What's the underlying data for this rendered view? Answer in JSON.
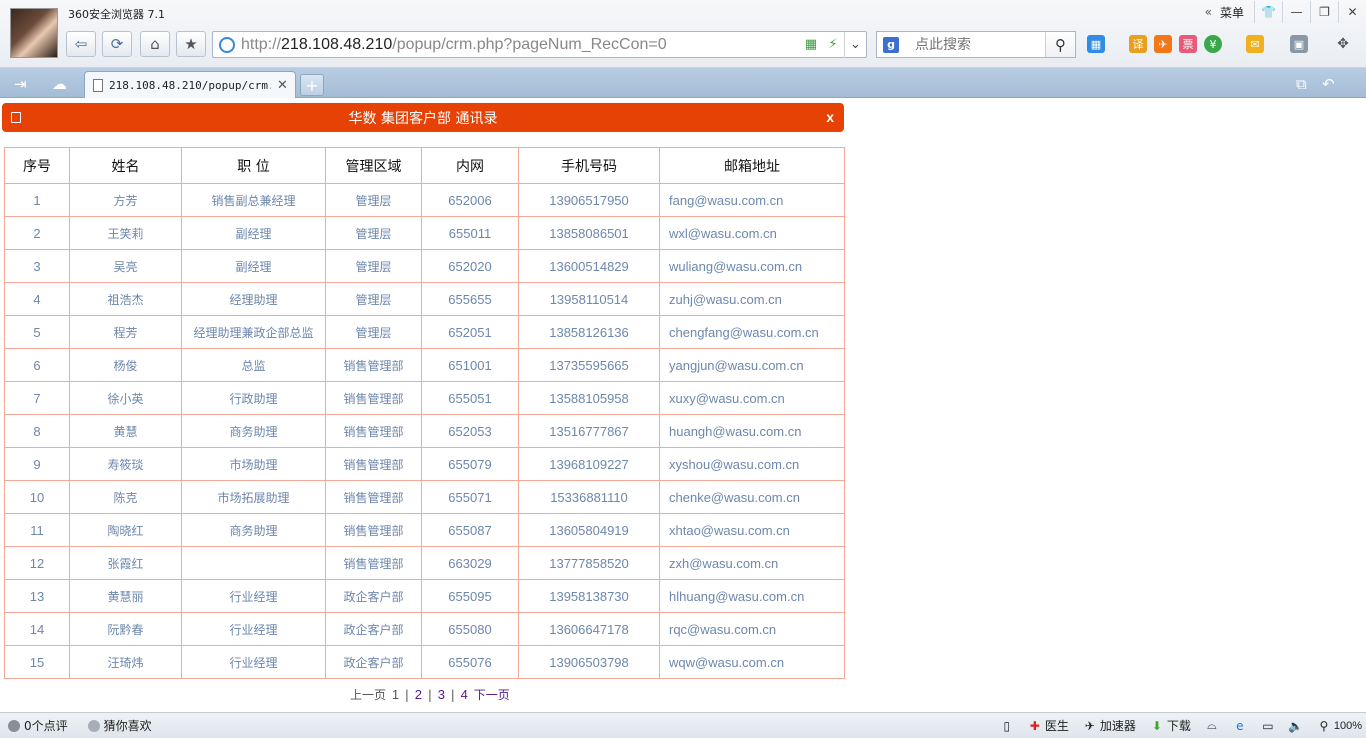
{
  "browser": {
    "app_title": "360安全浏览器 7.1",
    "menu_label": "菜单",
    "address_prefix": "http://",
    "address_host": "218.108.48.210",
    "address_path": "/popup/crm.php?pageNum_RecCon=0",
    "search_placeholder": "点此搜索",
    "tab_title": "218.108.48.210/popup/crm.php"
  },
  "page": {
    "header_title": "华数 集团客户部 通讯录",
    "close_label": "x",
    "columns": [
      "序号",
      "姓名",
      "职 位",
      "管理区域",
      "内网",
      "手机号码",
      "邮箱地址"
    ],
    "rows": [
      {
        "no": "1",
        "name": "方芳",
        "title": "销售副总兼经理",
        "area": "管理层",
        "ext": "652006",
        "mobile": "13906517950",
        "email": "fang@wasu.com.cn"
      },
      {
        "no": "2",
        "name": "王笑莉",
        "title": "副经理",
        "area": "管理层",
        "ext": "655011",
        "mobile": "13858086501",
        "email": "wxl@wasu.com.cn"
      },
      {
        "no": "3",
        "name": "吴亮",
        "title": "副经理",
        "area": "管理层",
        "ext": "652020",
        "mobile": "13600514829",
        "email": "wuliang@wasu.com.cn"
      },
      {
        "no": "4",
        "name": "祖浩杰",
        "title": "经理助理",
        "area": "管理层",
        "ext": "655655",
        "mobile": "13958110514",
        "email": "zuhj@wasu.com.cn"
      },
      {
        "no": "5",
        "name": "程芳",
        "title": "经理助理兼政企部总监",
        "area": "管理层",
        "ext": "652051",
        "mobile": "13858126136",
        "email": "chengfang@wasu.com.cn"
      },
      {
        "no": "6",
        "name": "杨俊",
        "title": "总监",
        "area": "销售管理部",
        "ext": "651001",
        "mobile": "13735595665",
        "email": "yangjun@wasu.com.cn"
      },
      {
        "no": "7",
        "name": "徐小英",
        "title": "行政助理",
        "area": "销售管理部",
        "ext": "655051",
        "mobile": "13588105958",
        "email": "xuxy@wasu.com.cn"
      },
      {
        "no": "8",
        "name": "黄慧",
        "title": "商务助理",
        "area": "销售管理部",
        "ext": "652053",
        "mobile": "13516777867",
        "email": "huangh@wasu.com.cn"
      },
      {
        "no": "9",
        "name": "寿筱琰",
        "title": "市场助理",
        "area": "销售管理部",
        "ext": "655079",
        "mobile": "13968109227",
        "email": "xyshou@wasu.com.cn"
      },
      {
        "no": "10",
        "name": "陈克",
        "title": "市场拓展助理",
        "area": "销售管理部",
        "ext": "655071",
        "mobile": "15336881110",
        "email": "chenke@wasu.com.cn"
      },
      {
        "no": "11",
        "name": "陶晓红",
        "title": "商务助理",
        "area": "销售管理部",
        "ext": "655087",
        "mobile": "13605804919",
        "email": "xhtao@wasu.com.cn"
      },
      {
        "no": "12",
        "name": "张霞红",
        "title": "",
        "area": "销售管理部",
        "ext": "663029",
        "mobile": "13777858520",
        "email": "zxh@wasu.com.cn"
      },
      {
        "no": "13",
        "name": "黄慧丽",
        "title": "行业经理",
        "area": "政企客户部",
        "ext": "655095",
        "mobile": "13958138730",
        "email": "hlhuang@wasu.com.cn"
      },
      {
        "no": "14",
        "name": "阮黔春",
        "title": "行业经理",
        "area": "政企客户部",
        "ext": "655080",
        "mobile": "13606647178",
        "email": "rqc@wasu.com.cn"
      },
      {
        "no": "15",
        "name": "汪琦炜",
        "title": "行业经理",
        "area": "政企客户部",
        "ext": "655076",
        "mobile": "13906503798",
        "email": "wqw@wasu.com.cn"
      }
    ],
    "pager": {
      "prev": "上一页",
      "current": "1",
      "pages": [
        "2",
        "3",
        "4"
      ],
      "separator": "|",
      "next": "下一页"
    }
  },
  "statusbar": {
    "comments": "0个点评",
    "guess": "猜你喜欢",
    "doctor": "医生",
    "accelerator": "加速器",
    "download": "下载",
    "zoom": "100%"
  },
  "colors": {
    "header_bg": "#e64206",
    "table_border": "#f4a898",
    "cell_text": "#6d87ad",
    "link_visited": "#551a8b"
  }
}
